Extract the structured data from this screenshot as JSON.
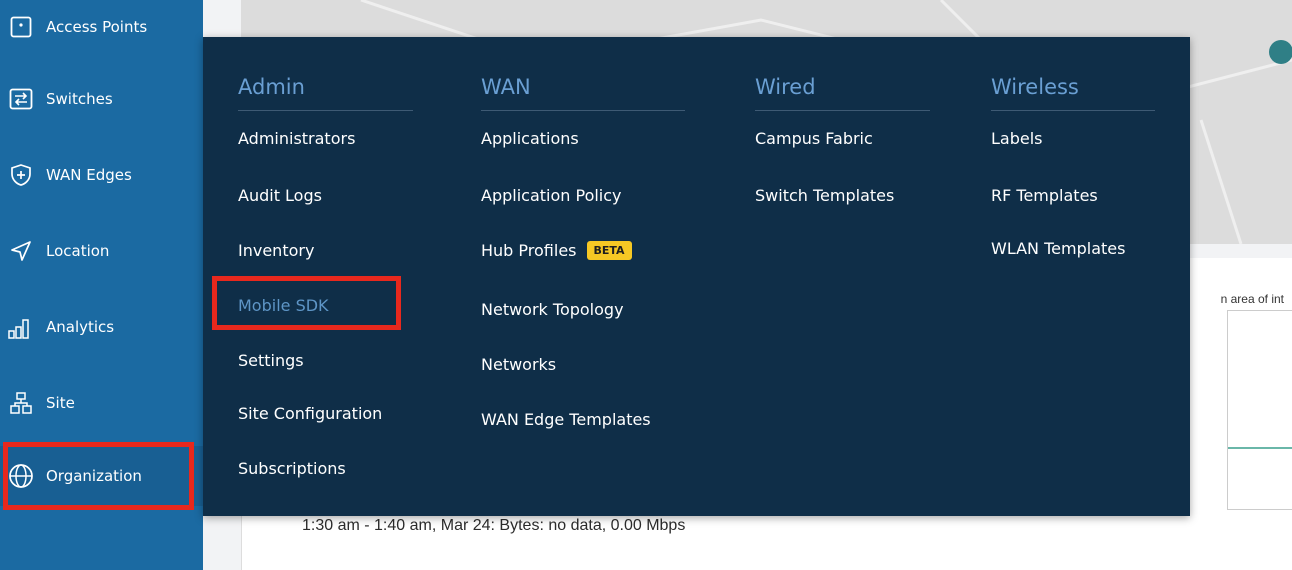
{
  "sidebar": {
    "items": [
      {
        "label": "Access Points",
        "icon": "access-point-icon"
      },
      {
        "label": "Switches",
        "icon": "switch-icon"
      },
      {
        "label": "WAN Edges",
        "icon": "wan-edge-icon"
      },
      {
        "label": "Location",
        "icon": "location-icon"
      },
      {
        "label": "Analytics",
        "icon": "analytics-icon"
      },
      {
        "label": "Site",
        "icon": "site-icon"
      },
      {
        "label": "Organization",
        "icon": "globe-icon"
      }
    ]
  },
  "background": {
    "footer_text": "1:30 am - 1:40 am, Mar 24: Bytes: no data, 0.00 Mbps",
    "panel_hint": "n area of int"
  },
  "menu": {
    "columns": [
      {
        "header": "Admin",
        "items": [
          "Administrators",
          "Audit Logs",
          "Inventory",
          "Mobile SDK",
          "Settings",
          "Site Configuration",
          "Subscriptions"
        ]
      },
      {
        "header": "WAN",
        "items": [
          "Applications",
          "Application Policy",
          "Hub Profiles",
          "Network Topology",
          "Networks",
          "WAN Edge Templates"
        ],
        "badge": "BETA"
      },
      {
        "header": "Wired",
        "items": [
          "Campus Fabric",
          "Switch Templates"
        ]
      },
      {
        "header": "Wireless",
        "items": [
          "Labels",
          "RF Templates",
          "WLAN Templates"
        ]
      }
    ]
  },
  "colors": {
    "sidebar_bg": "#1b6aa2",
    "menu_bg": "#0f2e48",
    "menu_header": "#6a9fd3",
    "highlight": "#e8281d",
    "beta_badge": "#f6c824"
  }
}
